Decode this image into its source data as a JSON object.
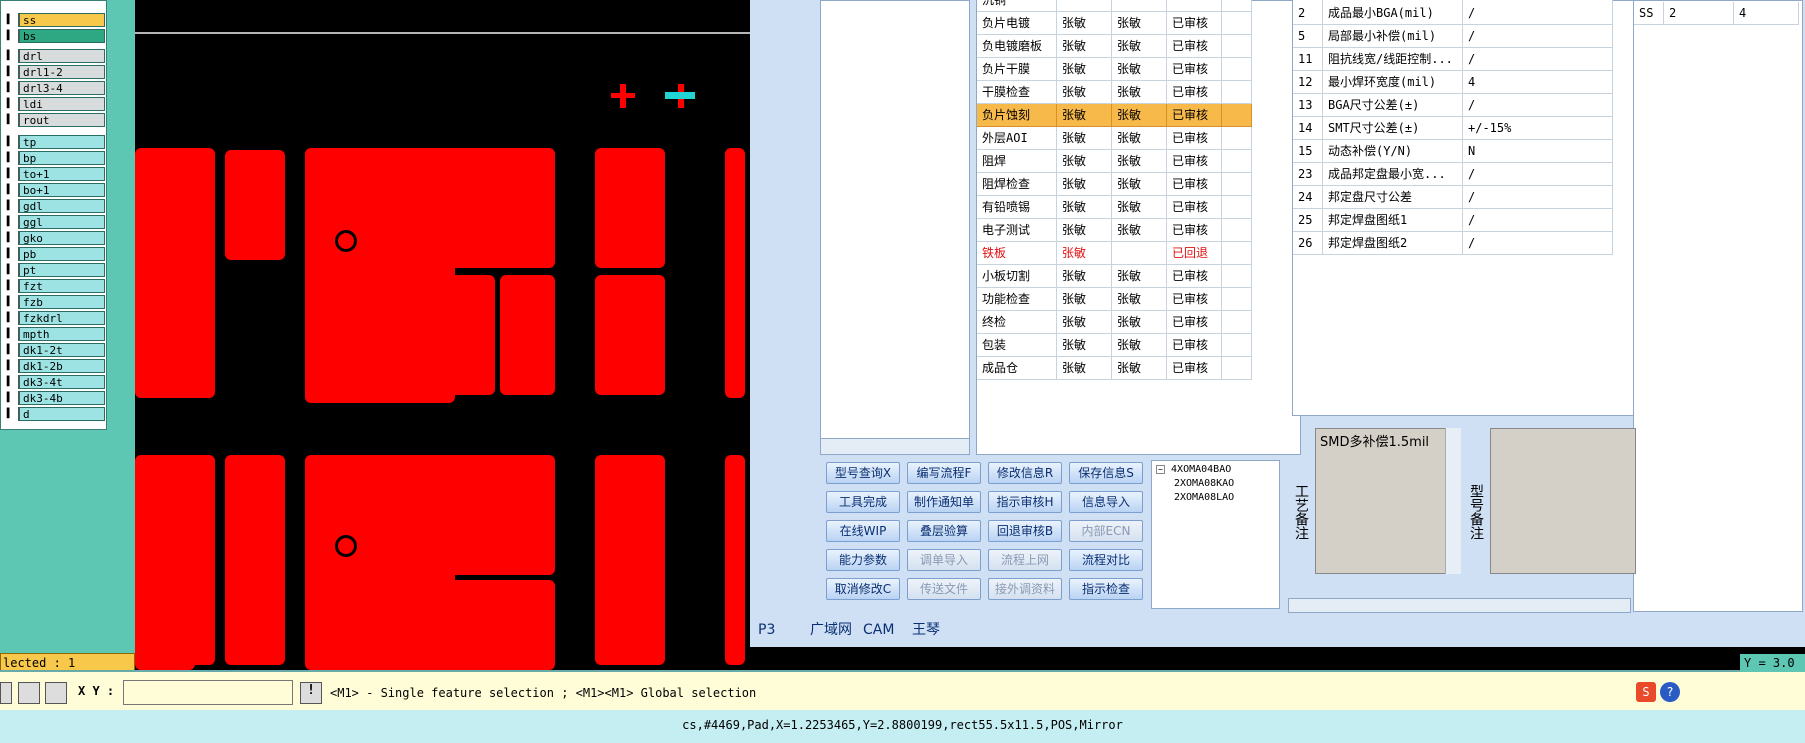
{
  "layers": [
    {
      "name": "ss",
      "style": "yl"
    },
    {
      "name": "bs",
      "style": "gr"
    },
    {
      "name": "drl",
      "style": "sv"
    },
    {
      "name": "drl1-2",
      "style": "sv"
    },
    {
      "name": "drl3-4",
      "style": "sv"
    },
    {
      "name": "ldi",
      "style": "sv"
    },
    {
      "name": "rout",
      "style": "sv"
    },
    {
      "name": "tp",
      "style": ""
    },
    {
      "name": "bp",
      "style": ""
    },
    {
      "name": "to+1",
      "style": ""
    },
    {
      "name": "bo+1",
      "style": ""
    },
    {
      "name": "gdl",
      "style": ""
    },
    {
      "name": "ggl",
      "style": ""
    },
    {
      "name": "gko",
      "style": ""
    },
    {
      "name": "pb",
      "style": ""
    },
    {
      "name": "pt",
      "style": ""
    },
    {
      "name": "fzt",
      "style": ""
    },
    {
      "name": "fzb",
      "style": ""
    },
    {
      "name": "fzkdrl",
      "style": ""
    },
    {
      "name": "mpth",
      "style": ""
    },
    {
      "name": "dk1-2t",
      "style": ""
    },
    {
      "name": "dk1-2b",
      "style": ""
    },
    {
      "name": "dk3-4t",
      "style": ""
    },
    {
      "name": "dk3-4b",
      "style": ""
    },
    {
      "name": "d",
      "style": ""
    }
  ],
  "selected_text": "lected : 1",
  "process_rows": [
    {
      "step": "负片电镀",
      "a": "张敏",
      "b": "张敏",
      "status": "已审核",
      "type": ""
    },
    {
      "step": "负电镀磨板",
      "a": "张敏",
      "b": "张敏",
      "status": "已审核",
      "type": ""
    },
    {
      "step": "负片干膜",
      "a": "张敏",
      "b": "张敏",
      "status": "已审核",
      "type": ""
    },
    {
      "step": "干膜检查",
      "a": "张敏",
      "b": "张敏",
      "status": "已审核",
      "type": ""
    },
    {
      "step": "负片蚀刻",
      "a": "张敏",
      "b": "张敏",
      "status": "已审核",
      "type": "sel"
    },
    {
      "step": "外层AOI",
      "a": "张敏",
      "b": "张敏",
      "status": "已审核",
      "type": ""
    },
    {
      "step": "阻焊",
      "a": "张敏",
      "b": "张敏",
      "status": "已审核",
      "type": ""
    },
    {
      "step": "阻焊检查",
      "a": "张敏",
      "b": "张敏",
      "status": "已审核",
      "type": ""
    },
    {
      "step": "有铅喷锡",
      "a": "张敏",
      "b": "张敏",
      "status": "已审核",
      "type": ""
    },
    {
      "step": "电子测试",
      "a": "张敏",
      "b": "张敏",
      "status": "已审核",
      "type": ""
    },
    {
      "step": "铁板",
      "a": "张敏",
      "b": "",
      "status": "已回退",
      "type": "red"
    },
    {
      "step": "小板切割",
      "a": "张敏",
      "b": "张敏",
      "status": "已审核",
      "type": ""
    },
    {
      "step": "功能检查",
      "a": "张敏",
      "b": "张敏",
      "status": "已审核",
      "type": ""
    },
    {
      "step": "终检",
      "a": "张敏",
      "b": "张敏",
      "status": "已审核",
      "type": ""
    },
    {
      "step": "包装",
      "a": "张敏",
      "b": "张敏",
      "status": "已审核",
      "type": ""
    },
    {
      "step": "成品仓",
      "a": "张敏",
      "b": "张敏",
      "status": "已审核",
      "type": ""
    }
  ],
  "first_row_partial": "沉铜",
  "param_rows": [
    {
      "id": "2",
      "name": "成品最小BGA(mil)",
      "val": "/"
    },
    {
      "id": "5",
      "name": "局部最小补偿(mil)",
      "val": "/"
    },
    {
      "id": "11",
      "name": "阻抗线宽/线距控制...",
      "val": "/"
    },
    {
      "id": "12",
      "name": "最小焊环宽度(mil)",
      "val": "4"
    },
    {
      "id": "13",
      "name": "BGA尺寸公差(±)",
      "val": "/"
    },
    {
      "id": "14",
      "name": "SMT尺寸公差(±)",
      "val": "+/-15%"
    },
    {
      "id": "15",
      "name": "动态补偿(Y/N)",
      "val": "N"
    },
    {
      "id": "23",
      "name": "成品邦定盘最小宽...",
      "val": "/"
    },
    {
      "id": "24",
      "name": "邦定盘尺寸公差",
      "val": "/"
    },
    {
      "id": "25",
      "name": "邦定焊盘图纸1",
      "val": "/"
    },
    {
      "id": "26",
      "name": "邦定焊盘图纸2",
      "val": "/"
    }
  ],
  "ss_row": {
    "a": "SS",
    "b": "2",
    "c": "4"
  },
  "buttons": [
    {
      "label": "型号查询X",
      "dis": false
    },
    {
      "label": "编写流程F",
      "dis": false
    },
    {
      "label": "修改信息R",
      "dis": false
    },
    {
      "label": "保存信息S",
      "dis": false
    },
    {
      "label": "工具完成",
      "dis": false
    },
    {
      "label": "制作通知单",
      "dis": false
    },
    {
      "label": "指示审核H",
      "dis": false
    },
    {
      "label": "信息导入",
      "dis": false
    },
    {
      "label": "在线WIP",
      "dis": false
    },
    {
      "label": "叠层验算",
      "dis": false
    },
    {
      "label": "回退审核B",
      "dis": false
    },
    {
      "label": "内部ECN",
      "dis": true
    },
    {
      "label": "能力参数",
      "dis": false
    },
    {
      "label": "调单导入",
      "dis": true
    },
    {
      "label": "流程上网",
      "dis": true
    },
    {
      "label": "流程对比",
      "dis": false
    },
    {
      "label": "取消修改C",
      "dis": false
    },
    {
      "label": "传送文件",
      "dis": true
    },
    {
      "label": "接外调资料",
      "dis": true
    },
    {
      "label": "指示检查",
      "dis": false
    }
  ],
  "tree": {
    "root": "4XOMA04BAO",
    "children": [
      "2XOMA08KAO",
      "2XOMA08LAO"
    ]
  },
  "remark_label": "工艺备注",
  "remark_text": "SMD多补偿1.5mil",
  "model_label": "型号备注",
  "tabs": {
    "p3": "P3",
    "a": "广域网",
    "b": "CAM",
    "c": "王琴"
  },
  "xy_label": "X Y :",
  "hint": "<M1> - Single feature selection ; <M1><M1> Global selection",
  "coord": "Y = 3.0",
  "feature_info": "cs,#4469,Pad,X=1.2253465,Y=2.8800199,rect55.5x11.5,POS,Mirror",
  "colors": {
    "copper": "#ff0000",
    "accent": "#f7b94a"
  }
}
